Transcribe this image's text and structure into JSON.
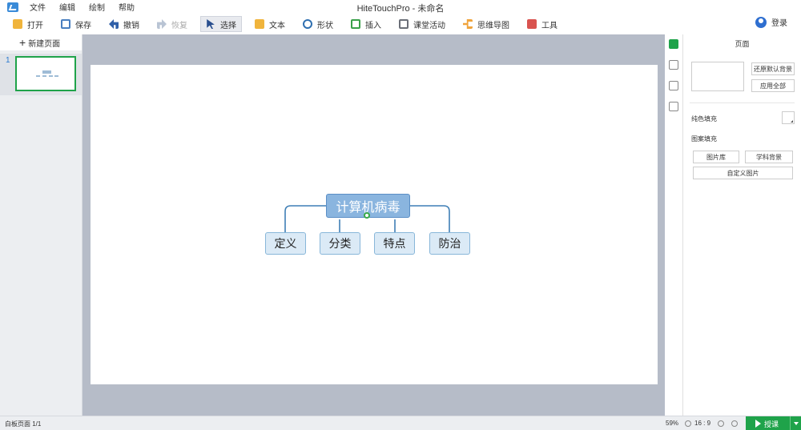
{
  "app": {
    "window_title": "HiteTouchPro - 未命名",
    "menu": [
      "文件",
      "编辑",
      "绘制",
      "帮助"
    ],
    "login_label": "登录"
  },
  "toolbar": {
    "open": "打开",
    "save": "保存",
    "undo": "撤销",
    "redo": "恢复",
    "select": "选择",
    "text": "文本",
    "shape": "形状",
    "insert": "插入",
    "class_activity": "课堂活动",
    "mind_map": "思维导图",
    "tools": "工具"
  },
  "left_panel": {
    "new_page_label": "新建页面",
    "page_number": "1"
  },
  "mind_map": {
    "root": "计算机病毒",
    "children": [
      "定义",
      "分类",
      "特点",
      "防治"
    ]
  },
  "right_panel": {
    "title": "页面",
    "restore_default_bg": "还原默认背景",
    "apply_all": "应用全部",
    "solid_fill": "纯色填充",
    "pattern_fill": "图案填充",
    "image_library": "图片库",
    "subject_bg": "学科背景",
    "custom_image": "自定义图片"
  },
  "status": {
    "page_info": "白板页面 1/1",
    "zoom": "59%",
    "ratio": "16 : 9",
    "teach_label": "授课"
  },
  "colors": {
    "accent_green": "#1fa34a",
    "node_root": "#8ab5df",
    "node_child": "#dbeaf6",
    "connector": "#3f7fb5"
  }
}
